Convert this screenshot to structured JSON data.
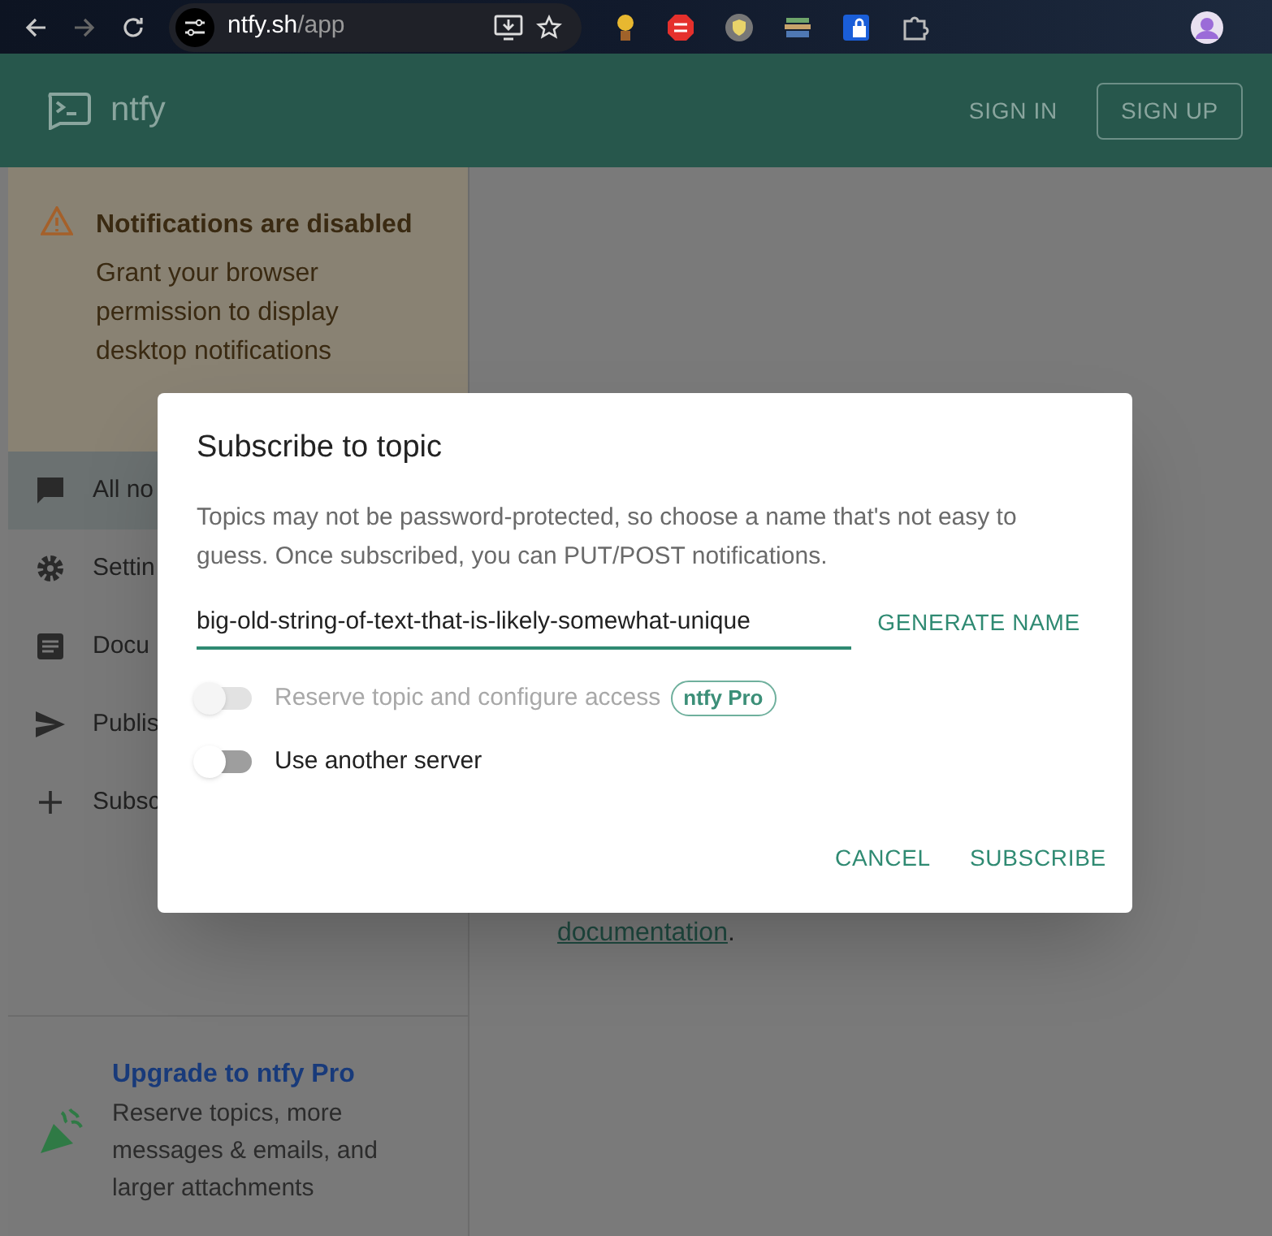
{
  "browser": {
    "url_host": "ntfy.sh",
    "url_path": "/app"
  },
  "header": {
    "app_name": "ntfy",
    "sign_in": "SIGN IN",
    "sign_up": "SIGN UP"
  },
  "notice": {
    "title": "Notifications are disabled",
    "text": "Grant your browser permission to display desktop notifications"
  },
  "sidebar": {
    "items": [
      {
        "kind": "chat",
        "label": "All no",
        "selected": true
      },
      {
        "kind": "gear",
        "label": "Settin",
        "selected": false
      },
      {
        "kind": "document",
        "label": "Docu",
        "selected": false
      },
      {
        "kind": "send",
        "label": "Publis",
        "selected": false
      },
      {
        "kind": "plus",
        "label": "Subsc",
        "selected": false
      }
    ]
  },
  "main": {
    "link": "documentation",
    "text_after": "."
  },
  "upgrade": {
    "title": "Upgrade to ntfy Pro",
    "text": "Reserve topics, more messages & emails, and larger attachments"
  },
  "dialog": {
    "title": "Subscribe to topic",
    "description": "Topics may not be password-protected, so choose a name that's not easy to guess. Once subscribed, you can PUT/POST notifications.",
    "topic_value": "big-old-string-of-text-that-is-likely-somewhat-unique",
    "generate_button": "GENERATE NAME",
    "toggles": [
      {
        "label": "Reserve topic and configure access",
        "on": false,
        "disabled": true,
        "badge": "ntfy Pro"
      },
      {
        "label": "Use another server",
        "on": false,
        "disabled": false
      }
    ],
    "buttons": [
      "CANCEL",
      "SUBSCRIBE"
    ]
  }
}
